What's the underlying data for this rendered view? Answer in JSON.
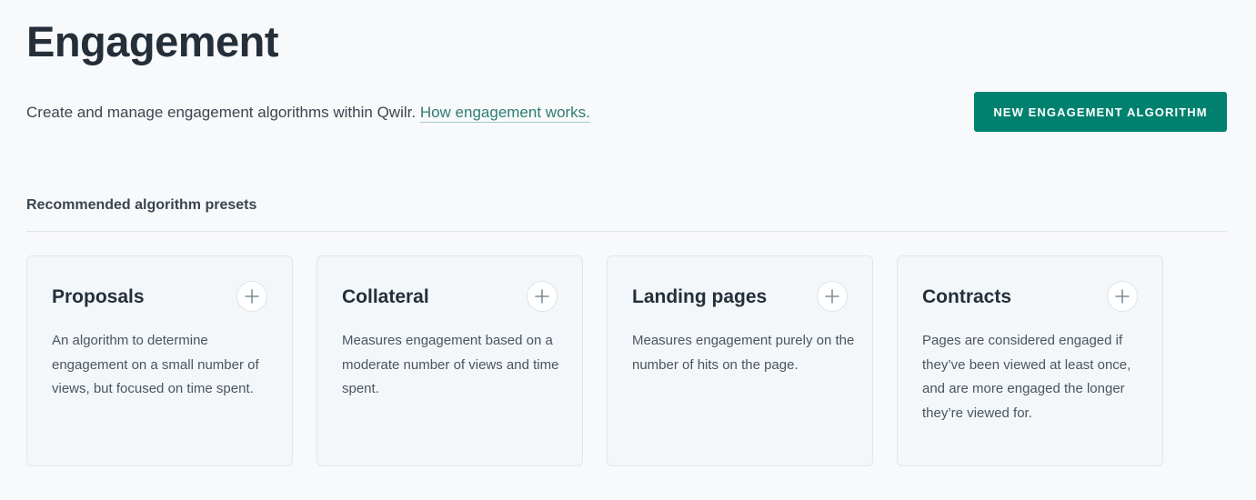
{
  "header": {
    "title": "Engagement",
    "intro_text": "Create and manage engagement algorithms within Qwilr.",
    "intro_link": "How engagement works.",
    "new_button_label": "New Engagement Algorithm"
  },
  "presets": {
    "heading": "Recommended algorithm presets",
    "cards": [
      {
        "title": "Proposals",
        "description": "An algorithm to determine engagement on a small number of views, but focused on time spent."
      },
      {
        "title": "Collateral",
        "description": "Measures engagement based on a moderate number of views and time spent."
      },
      {
        "title": "Landing pages",
        "description": "Measures engagement purely on the number of hits on the page."
      },
      {
        "title": "Contracts",
        "description": "Pages are considered engaged if they’ve been viewed at least once, and are more engaged the longer they’re viewed for."
      }
    ]
  },
  "colors": {
    "accent": "#00816f",
    "link": "#2e7d72",
    "background": "#f8f9fb",
    "card_background": "#f4f7fa"
  },
  "icons": {
    "add": "plus-icon"
  }
}
